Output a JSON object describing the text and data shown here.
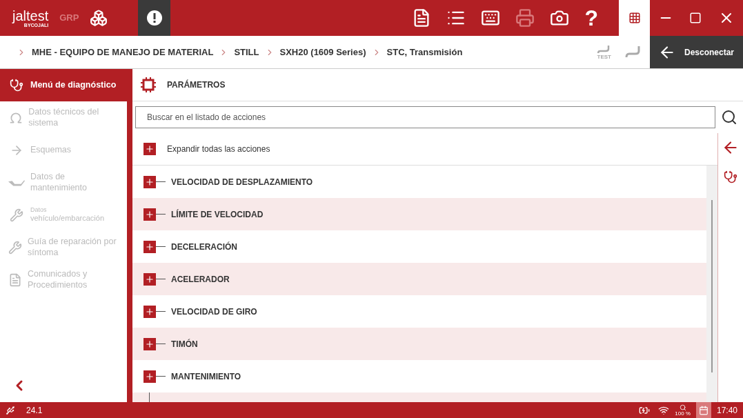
{
  "header": {
    "logo": "jaltest",
    "logo_sub": "BYCOJALI",
    "grp": "GRP",
    "help": "?"
  },
  "breadcrumb": [
    "MHE - EQUIPO DE MANEJO DE MATERIAL",
    "STILL",
    "SXH20 (1609 Series)",
    "STC, Transmisión"
  ],
  "test_label": "TEST",
  "disconnect": "Desconectar",
  "sidebar": {
    "items": [
      {
        "label": "Menú de diagnóstico",
        "selected": true
      },
      {
        "label": "Datos técnicos del sistema",
        "selected": false
      },
      {
        "label": "Esquemas",
        "selected": false
      },
      {
        "label": "Datos de mantenimiento",
        "selected": false
      },
      {
        "label": "vehículo/embarcación",
        "prefix": "Datos",
        "selected": false
      },
      {
        "label": "Guía de reparación por síntoma",
        "selected": false
      },
      {
        "label": "Comunicados y Procedimientos",
        "selected": false
      }
    ]
  },
  "panel": {
    "title": "PARÁMETROS",
    "search": {
      "placeholder": "Buscar en el listado de acciones"
    },
    "expand_all": "Expandir todas las acciones",
    "rows": [
      {
        "label": "VELOCIDAD DE DESPLAZAMIENTO"
      },
      {
        "label": "LÍMITE DE VELOCIDAD"
      },
      {
        "label": "DECELERACIÓN"
      },
      {
        "label": "ACELERADOR"
      },
      {
        "label": "VELOCIDAD DE GIRO"
      },
      {
        "label": "TIMÓN"
      },
      {
        "label": "MANTENIMIENTO"
      }
    ]
  },
  "status_bar": {
    "version": "24.1",
    "zoom": "100 %",
    "time": "17:40"
  }
}
